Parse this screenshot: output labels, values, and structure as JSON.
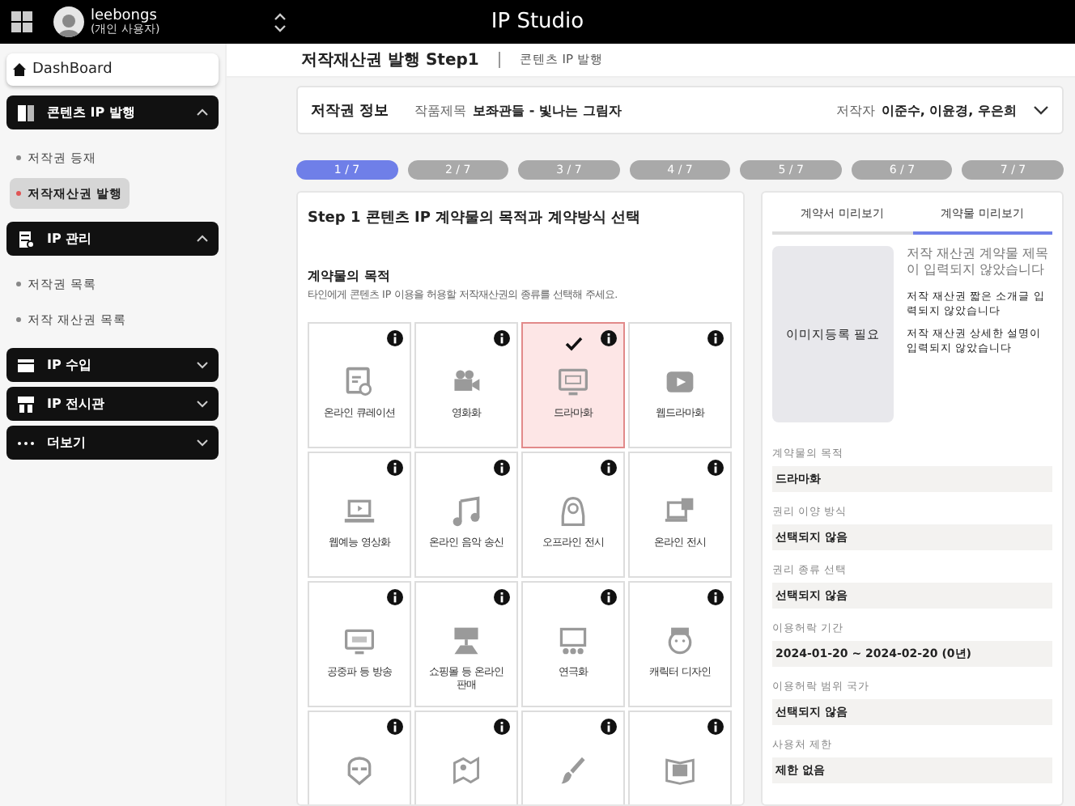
{
  "topbar": {
    "user_name": "leebongs",
    "user_role": "(개인 사용자)",
    "app_title": "IP Studio"
  },
  "sidebar": {
    "dashboard": "DashBoard",
    "groups": [
      {
        "label": "콘텐츠 IP 발행",
        "expanded": true,
        "items": [
          {
            "label": "저작권 등재",
            "selected": false
          },
          {
            "label": "저작재산권 발행",
            "selected": true
          }
        ]
      },
      {
        "label": "IP 관리",
        "expanded": true,
        "items": [
          {
            "label": "저작권 목록",
            "selected": false
          },
          {
            "label": "저작 재산권 목록",
            "selected": false
          }
        ]
      },
      {
        "label": "IP 수입",
        "expanded": false
      },
      {
        "label": "IP 전시관",
        "expanded": false
      },
      {
        "label": "더보기",
        "expanded": false
      }
    ]
  },
  "header": {
    "title": "저작재산권 발행 Step1",
    "breadcrumb": "콘텐츠 IP 발행"
  },
  "info": {
    "heading": "저작권 정보",
    "work_label": "작품제목",
    "work_title": "보좌관들 - 빛나는 그림자",
    "author_label": "저작자",
    "authors": "이준수, 이윤경, 우은희"
  },
  "steps": [
    {
      "label": "1 / 7",
      "selected": true
    },
    {
      "label": "2 / 7",
      "selected": false
    },
    {
      "label": "3 / 7",
      "selected": false
    },
    {
      "label": "4 / 7",
      "selected": false
    },
    {
      "label": "5 / 7",
      "selected": false
    },
    {
      "label": "6 / 7",
      "selected": false
    },
    {
      "label": "7 / 7",
      "selected": false
    }
  ],
  "step_panel": {
    "title": "Step 1 콘텐츠 IP 계약물의 목적과 계약방식 선택",
    "section_title": "계약물의 목적",
    "section_hint": "타인에게 콘텐츠 IP 이용을 허용할 저작재산권의 종류를 선택해 주세요.",
    "options": [
      {
        "label": "온라인 큐레이션",
        "selected": false
      },
      {
        "label": "영화화",
        "selected": false
      },
      {
        "label": "드라마화",
        "selected": true
      },
      {
        "label": "웹드라마화",
        "selected": false
      },
      {
        "label": "웹예능 영상화",
        "selected": false
      },
      {
        "label": "온라인 음악 송신",
        "selected": false
      },
      {
        "label": "오프라인 전시",
        "selected": false
      },
      {
        "label": "온라인 전시",
        "selected": false
      },
      {
        "label": "공중파 등 방송",
        "selected": false
      },
      {
        "label": "쇼핑몰 등 온라인 판매",
        "selected": false
      },
      {
        "label": "연극화",
        "selected": false
      },
      {
        "label": "캐릭터 디자인",
        "selected": false
      },
      {
        "selected": false
      },
      {
        "selected": false
      },
      {
        "selected": false
      },
      {
        "selected": false
      }
    ]
  },
  "preview": {
    "tabs": [
      {
        "label": "계약서 미리보기",
        "selected": false
      },
      {
        "label": "계약물 미리보기",
        "selected": true
      }
    ],
    "image_placeholder": "이미지등록 필요",
    "title_note": "저작 재산권 계약물 제목이 입력되지 않았습니다",
    "notes": [
      "저작 재산권 짧은 소개글 입력되지 않았습니다",
      "저작 재산권 상세한 설명이 입력되지 않았습니다"
    ],
    "fields": [
      {
        "label": "계약물의 목적",
        "value": "드라마화"
      },
      {
        "label": "권리 이양 방식",
        "value": "선택되지 않음"
      },
      {
        "label": "권리 종류 선택",
        "value": "선택되지 않음"
      },
      {
        "label": "이용허락 기간",
        "value": "2024-01-20 ~ 2024-02-20 (0년)"
      },
      {
        "label": "이용허락 범위 국가",
        "value": "선택되지 않음"
      },
      {
        "label": "사용처 제한",
        "value": "제한 없음"
      }
    ]
  }
}
